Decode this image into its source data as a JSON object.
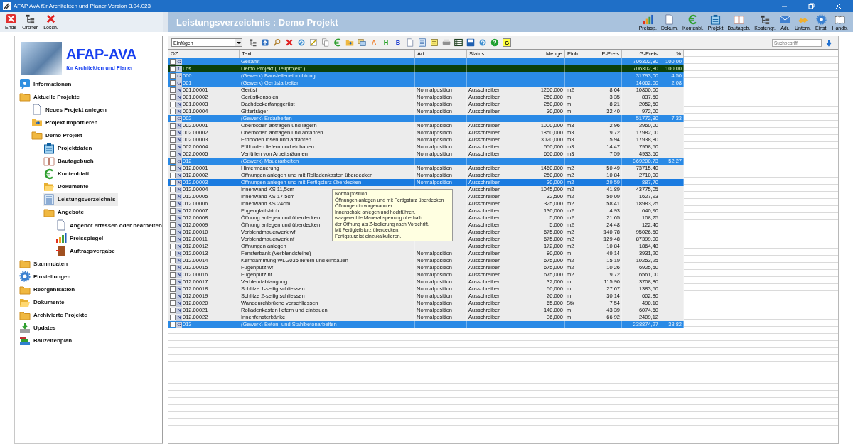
{
  "window": {
    "title": "AFAP AVA für Architekten und Planer Version 3.04.023"
  },
  "quick_buttons": [
    {
      "label": "Ende",
      "kind": "close"
    },
    {
      "label": "Ordner",
      "kind": "tree"
    },
    {
      "label": "Lösch.",
      "kind": "delete"
    }
  ],
  "header": {
    "title": "Leistungsverzeichnis : Demo Projekt"
  },
  "app_buttons": [
    {
      "label": "Preissp.",
      "kind": "chart"
    },
    {
      "label": "Dokum.",
      "kind": "document"
    },
    {
      "label": "Kontenbl.",
      "kind": "euro"
    },
    {
      "label": "Projekt",
      "kind": "project"
    },
    {
      "label": "Bautageb.",
      "kind": "book"
    },
    {
      "label": "Kostengr.",
      "kind": "tree"
    },
    {
      "label": "Adr.",
      "kind": "mail"
    },
    {
      "label": "Untern.",
      "kind": "hand"
    },
    {
      "label": "Einst.",
      "kind": "gear"
    },
    {
      "label": "Handb.",
      "kind": "manual"
    }
  ],
  "logo": {
    "name": "AFAP-AVA",
    "tagline": "für Architekten und Planer"
  },
  "sidebar": {
    "items": [
      {
        "label": "Informationen",
        "kind": "info",
        "selected": false
      },
      {
        "label": "Aktuelle Projekte",
        "kind": "folder",
        "selected": false,
        "children": [
          {
            "label": "Neues Projekt anlegen",
            "kind": "document",
            "selected": false
          },
          {
            "label": "Projekt importieren",
            "kind": "import",
            "selected": false
          },
          {
            "label": "Demo Projekt",
            "kind": "folder",
            "selected": false,
            "children": [
              {
                "label": "Projektdaten",
                "kind": "project",
                "selected": false
              },
              {
                "label": "Bautagebuch",
                "kind": "book",
                "selected": false
              },
              {
                "label": "Kontenblatt",
                "kind": "euro",
                "selected": false
              },
              {
                "label": "Dokumente",
                "kind": "folder-open",
                "selected": false
              },
              {
                "label": "Leistungsverzeichnis",
                "kind": "list",
                "selected": true
              },
              {
                "label": "Angebote",
                "kind": "folder",
                "selected": false,
                "children": [
                  {
                    "label": "Angebot erfassen oder bearbeiten",
                    "kind": "document",
                    "selected": false
                  },
                  {
                    "label": "Preisspiegel",
                    "kind": "chart",
                    "selected": false
                  },
                  {
                    "label": "Auftragsvergabe",
                    "kind": "door",
                    "selected": false
                  }
                ]
              }
            ]
          }
        ]
      },
      {
        "label": "Stammdaten",
        "kind": "folder",
        "selected": false
      },
      {
        "label": "Einstellungen",
        "kind": "gear",
        "selected": false
      },
      {
        "label": "Reorganisation",
        "kind": "folder",
        "selected": false
      },
      {
        "label": "Dokumente",
        "kind": "folder-open",
        "selected": false
      },
      {
        "label": "Archivierte Projekte",
        "kind": "folder",
        "selected": false
      },
      {
        "label": "Updates",
        "kind": "download",
        "selected": false
      },
      {
        "label": "Bauzeitenplan",
        "kind": "gantt",
        "selected": false
      }
    ]
  },
  "toolbar": {
    "dropdown": "Einfügen",
    "tools": [
      {
        "kind": "tree"
      },
      {
        "kind": "upload"
      },
      {
        "kind": "search"
      },
      {
        "kind": "delete"
      },
      {
        "kind": "refresh"
      },
      {
        "kind": "edit"
      },
      {
        "kind": "copy"
      },
      {
        "kind": "euro"
      },
      {
        "kind": "import"
      },
      {
        "kind": "windows"
      },
      {
        "kind": "glyph",
        "glyph": "A",
        "color": "#f07820"
      },
      {
        "kind": "glyph",
        "glyph": "H",
        "color": "#20a020"
      },
      {
        "kind": "glyph",
        "glyph": "B",
        "color": "#2040d0"
      },
      {
        "kind": "document"
      },
      {
        "kind": "list"
      },
      {
        "kind": "note"
      },
      {
        "kind": "print"
      },
      {
        "kind": "table"
      },
      {
        "kind": "save"
      },
      {
        "kind": "refresh"
      },
      {
        "kind": "help"
      },
      {
        "kind": "glyph",
        "glyph": "G",
        "color": "#ffff40"
      }
    ],
    "search_placeholder": "Suchbegriff"
  },
  "table": {
    "columns": [
      "OZ",
      "Text",
      "Art",
      "Status",
      "Menge",
      "Einh.",
      "E-Preis",
      "G-Preis",
      "%"
    ],
    "rows": [
      {
        "kind": "group",
        "marker": "G",
        "checked": false,
        "selected": false,
        "oz": "",
        "text": "Gesamt",
        "gpreis": "706302,80",
        "pct": "100,00"
      },
      {
        "kind": "lot",
        "marker": "L",
        "checked": false,
        "selected": false,
        "oz": "Los",
        "text": "Demo Projekt ( Teilprojekt )",
        "gpreis": "706302,80",
        "pct": "100,00"
      },
      {
        "kind": "group",
        "marker": "G",
        "checked": false,
        "selected": false,
        "oz": "000",
        "text": "(Gewerk) Baustelleneinrichtung",
        "gpreis": "31793,00",
        "pct": "4,50"
      },
      {
        "kind": "group",
        "marker": "G",
        "checked": false,
        "selected": false,
        "oz": "001",
        "text": "(Gewerk) Gerüstarbeiten",
        "gpreis": "14662,00",
        "pct": "2,08"
      },
      {
        "kind": "position",
        "marker": "N",
        "checked": false,
        "selected": false,
        "oz": "001.00001",
        "text": "Gerüst",
        "art": "Normalposition",
        "status": "Ausschreiben",
        "menge": "1250,000",
        "einh": "m2",
        "epreis": "8,64",
        "gpreis": "10800,00"
      },
      {
        "kind": "position",
        "marker": "N",
        "checked": false,
        "selected": false,
        "oz": "001.00002",
        "text": "Gerüstkonsolen",
        "art": "Normalposition",
        "status": "Ausschreiben",
        "menge": "250,000",
        "einh": "m",
        "epreis": "3,35",
        "gpreis": "837,50"
      },
      {
        "kind": "position",
        "marker": "N",
        "checked": false,
        "selected": false,
        "oz": "001.00003",
        "text": "Dachdeckerfanggerüst",
        "art": "Normalposition",
        "status": "Ausschreiben",
        "menge": "250,000",
        "einh": "m",
        "epreis": "8,21",
        "gpreis": "2052,50"
      },
      {
        "kind": "position",
        "marker": "N",
        "checked": false,
        "selected": false,
        "oz": "001.00004",
        "text": "Gitterträger",
        "art": "Normalposition",
        "status": "Ausschreiben",
        "menge": "30,000",
        "einh": "m",
        "epreis": "32,40",
        "gpreis": "972,00"
      },
      {
        "kind": "group",
        "marker": "G",
        "checked": false,
        "selected": false,
        "oz": "002",
        "text": "(Gewerk) Erdarbeiten",
        "gpreis": "51772,80",
        "pct": "7,33"
      },
      {
        "kind": "position",
        "marker": "N",
        "checked": false,
        "selected": false,
        "oz": "002.00001",
        "text": "Oberboden abtragen und lagern",
        "art": "Normalposition",
        "status": "Ausschreiben",
        "menge": "1000,000",
        "einh": "m3",
        "epreis": "2,96",
        "gpreis": "2960,00"
      },
      {
        "kind": "position",
        "marker": "N",
        "checked": false,
        "selected": false,
        "oz": "002.00002",
        "text": "Oberboden abtragen und abfahren",
        "art": "Normalposition",
        "status": "Ausschreiben",
        "menge": "1850,000",
        "einh": "m3",
        "epreis": "9,72",
        "gpreis": "17982,00"
      },
      {
        "kind": "position",
        "marker": "N",
        "checked": false,
        "selected": false,
        "oz": "002.00003",
        "text": "Erdboden lösen und abfahren",
        "art": "Normalposition",
        "status": "Ausschreiben",
        "menge": "3020,000",
        "einh": "m3",
        "epreis": "5,94",
        "gpreis": "17938,80"
      },
      {
        "kind": "position",
        "marker": "N",
        "checked": false,
        "selected": false,
        "oz": "002.00004",
        "text": "Füllboden liefern und einbauen",
        "art": "Normalposition",
        "status": "Ausschreiben",
        "menge": "550,000",
        "einh": "m3",
        "epreis": "14,47",
        "gpreis": "7958,50"
      },
      {
        "kind": "position",
        "marker": "N",
        "checked": false,
        "selected": false,
        "oz": "002.00005",
        "text": "Verfüllen von Arbeitsräumen",
        "art": "Normalposition",
        "status": "Ausschreiben",
        "menge": "650,000",
        "einh": "m3",
        "epreis": "7,59",
        "gpreis": "4933,50"
      },
      {
        "kind": "group",
        "marker": "G",
        "checked": false,
        "selected": false,
        "oz": "012",
        "text": "(Gewerk) Mauerarbeiten",
        "gpreis": "369200,73",
        "pct": "52,27"
      },
      {
        "kind": "position",
        "marker": "N",
        "checked": false,
        "selected": false,
        "oz": "012.00001",
        "text": "Hintermauerung",
        "art": "Normalposition",
        "status": "Ausschreiben",
        "menge": "1460,000",
        "einh": "m2",
        "epreis": "50,49",
        "gpreis": "73715,40"
      },
      {
        "kind": "position",
        "marker": "N",
        "checked": false,
        "selected": false,
        "oz": "012.00002",
        "text": "Öffnungen anlegen und mit Rolladenkasten überdecken",
        "art": "Normalposition",
        "status": "Ausschreiben",
        "menge": "250,000",
        "einh": "m2",
        "epreis": "10,84",
        "gpreis": "2710,00"
      },
      {
        "kind": "position",
        "marker": "N",
        "checked": false,
        "selected": true,
        "oz": "012.00003",
        "text": "Öffnungen anlegen und mit Fertigsturz überdecken",
        "art": "Normalposition",
        "status": "Ausschreiben",
        "menge": "30,000",
        "einh": "m2",
        "epreis": "29,59",
        "gpreis": "887,70"
      },
      {
        "kind": "position",
        "marker": "N",
        "checked": false,
        "selected": false,
        "oz": "012.00004",
        "text": "Innenwand KS 11,5cm",
        "status": "Ausschreiben",
        "menge": "1045,000",
        "einh": "m2",
        "epreis": "41,89",
        "gpreis": "43775,05"
      },
      {
        "kind": "position",
        "marker": "N",
        "checked": false,
        "selected": false,
        "oz": "012.00005",
        "text": "Innenwand KS 17,5cm",
        "status": "Ausschreiben",
        "menge": "32,500",
        "einh": "m2",
        "epreis": "50,09",
        "gpreis": "1627,93"
      },
      {
        "kind": "position",
        "marker": "N",
        "checked": false,
        "selected": false,
        "oz": "012.00006",
        "text": "Innenwand KS 24cm",
        "status": "Ausschreiben",
        "menge": "325,000",
        "einh": "m2",
        "epreis": "58,41",
        "gpreis": "18983,25"
      },
      {
        "kind": "position",
        "marker": "N",
        "checked": false,
        "selected": false,
        "oz": "012.00007",
        "text": "Fugenglattstrich",
        "status": "Ausschreiben",
        "menge": "130,000",
        "einh": "m2",
        "epreis": "4,93",
        "gpreis": "640,90"
      },
      {
        "kind": "position",
        "marker": "N",
        "checked": false,
        "selected": false,
        "oz": "012.00008",
        "text": "Öffnung anlegen und überdecken",
        "status": "Ausschreiben",
        "menge": "5,000",
        "einh": "m2",
        "epreis": "21,65",
        "gpreis": "108,25"
      },
      {
        "kind": "position",
        "marker": "N",
        "checked": false,
        "selected": false,
        "oz": "012.00009",
        "text": "Öffnung anlegen und überdecken",
        "status": "Ausschreiben",
        "menge": "5,000",
        "einh": "m2",
        "epreis": "24,48",
        "gpreis": "122,40"
      },
      {
        "kind": "position",
        "marker": "N",
        "checked": false,
        "selected": false,
        "oz": "012.00010",
        "text": "Verblendmauerwerk wf",
        "status": "Ausschreiben",
        "menge": "675,000",
        "einh": "m2",
        "epreis": "140,78",
        "gpreis": "95026,50"
      },
      {
        "kind": "position",
        "marker": "N",
        "checked": false,
        "selected": false,
        "oz": "012.00011",
        "text": "Verblendmauerwerk nf",
        "status": "Ausschreiben",
        "menge": "675,000",
        "einh": "m2",
        "epreis": "129,48",
        "gpreis": "87399,00"
      },
      {
        "kind": "position",
        "marker": "N",
        "checked": false,
        "selected": false,
        "oz": "012.00012",
        "text": "Öffnungen anlegen",
        "status": "Ausschreiben",
        "menge": "172,000",
        "einh": "m2",
        "epreis": "10,84",
        "gpreis": "1864,48"
      },
      {
        "kind": "position",
        "marker": "N",
        "checked": false,
        "selected": false,
        "oz": "012.00013",
        "text": "Fensterbank (Verblendsteine)",
        "art": "Normalposition",
        "status": "Ausschreiben",
        "menge": "80,000",
        "einh": "m",
        "epreis": "49,14",
        "gpreis": "3931,20"
      },
      {
        "kind": "position",
        "marker": "N",
        "checked": false,
        "selected": false,
        "oz": "012.00014",
        "text": "Kerndämmung WLG035 liefern und einbauen",
        "art": "Normalposition",
        "status": "Ausschreiben",
        "menge": "675,000",
        "einh": "m2",
        "epreis": "15,19",
        "gpreis": "10253,25"
      },
      {
        "kind": "position",
        "marker": "N",
        "checked": false,
        "selected": false,
        "oz": "012.00015",
        "text": "Fugenputz wf",
        "art": "Normalposition",
        "status": "Ausschreiben",
        "menge": "675,000",
        "einh": "m2",
        "epreis": "10,26",
        "gpreis": "6925,50"
      },
      {
        "kind": "position",
        "marker": "N",
        "checked": false,
        "selected": false,
        "oz": "012.00016",
        "text": "Fugenputz nf",
        "art": "Normalposition",
        "status": "Ausschreiben",
        "menge": "675,000",
        "einh": "m2",
        "epreis": "9,72",
        "gpreis": "6561,00"
      },
      {
        "kind": "position",
        "marker": "N",
        "checked": false,
        "selected": false,
        "oz": "012.00017",
        "text": "Verblendabfangung",
        "art": "Normalposition",
        "status": "Ausschreiben",
        "menge": "32,000",
        "einh": "m",
        "epreis": "115,90",
        "gpreis": "3708,80"
      },
      {
        "kind": "position",
        "marker": "N",
        "checked": false,
        "selected": false,
        "oz": "012.00018",
        "text": "Schlitze 1-seitig schliessen",
        "art": "Normalposition",
        "status": "Ausschreiben",
        "menge": "50,000",
        "einh": "m",
        "epreis": "27,67",
        "gpreis": "1383,50"
      },
      {
        "kind": "position",
        "marker": "N",
        "checked": false,
        "selected": false,
        "oz": "012.00019",
        "text": "Schlitze 2-seitig schliessen",
        "art": "Normalposition",
        "status": "Ausschreiben",
        "menge": "20,000",
        "einh": "m",
        "epreis": "30,14",
        "gpreis": "602,80"
      },
      {
        "kind": "position",
        "marker": "N",
        "checked": false,
        "selected": false,
        "oz": "012.00020",
        "text": "Wanddurchbrüche verschliessen",
        "art": "Normalposition",
        "status": "Ausschreiben",
        "menge": "65,000",
        "einh": "Stk",
        "epreis": "7,54",
        "gpreis": "490,10"
      },
      {
        "kind": "position",
        "marker": "N",
        "checked": false,
        "selected": false,
        "oz": "012.00021",
        "text": "Rolladenkasten liefern und einbauen",
        "art": "Normalposition",
        "status": "Ausschreiben",
        "menge": "140,000",
        "einh": "m",
        "epreis": "43,39",
        "gpreis": "6074,60"
      },
      {
        "kind": "position",
        "marker": "N",
        "checked": false,
        "selected": false,
        "oz": "012.00022",
        "text": "Innenfensterbänke",
        "art": "Normalposition",
        "status": "Ausschreiben",
        "menge": "36,000",
        "einh": "m",
        "epreis": "66,92",
        "gpreis": "2409,12"
      },
      {
        "kind": "group",
        "marker": "G",
        "checked": false,
        "selected": false,
        "oz": "013",
        "text": "(Gewerk) Beton- und Stahlbetonarbeiten",
        "gpreis": "238874,27",
        "pct": "33,82"
      }
    ]
  },
  "tooltip": {
    "lines": [
      "Normalposition",
      "Öffnungen anlegen und mit Fertigsturz überdecken",
      "Öffnungen in vorgenannter",
      "Innenschale anlegen und hochführen,",
      "waagerechte Mauerabsperrung oberhalb",
      "der Öffnung als Z-Isolierung nach Vorschrift.",
      "Mit Fertigteilsturz überdecken.",
      "Fertigsturz ist einzukalkulieren."
    ]
  }
}
